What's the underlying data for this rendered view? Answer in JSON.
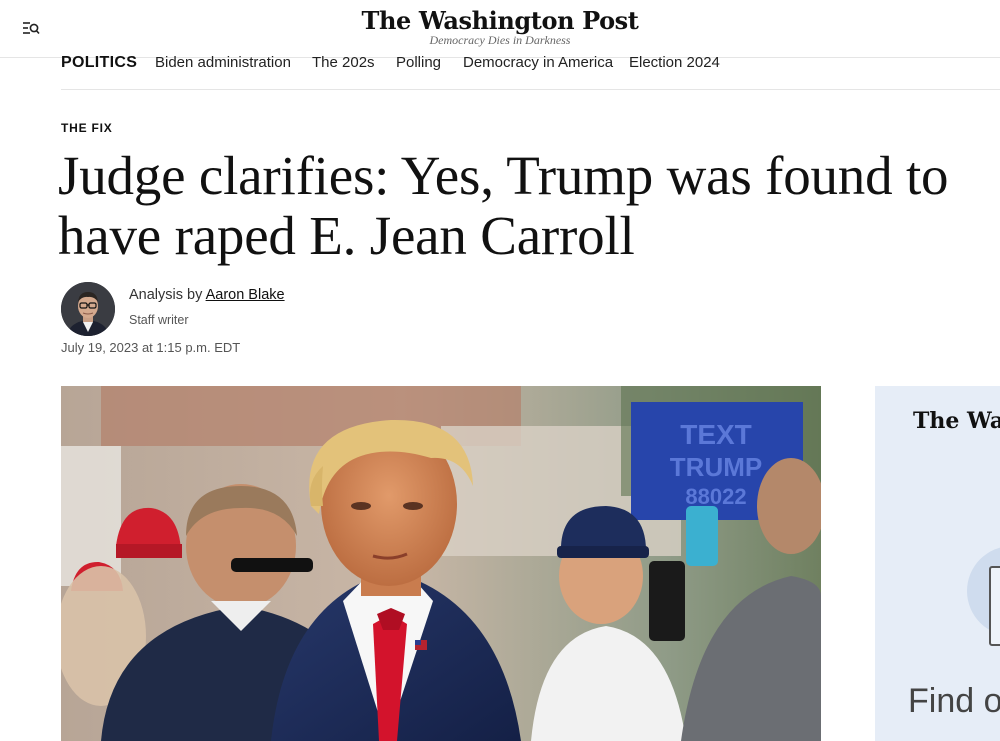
{
  "header": {
    "masthead": "The Washington Post",
    "tagline": "Democracy Dies in Darkness"
  },
  "nav": {
    "section": "POLITICS",
    "items": [
      "Biden administration",
      "The 202s",
      "Polling",
      "Democracy in America",
      "Election 2024"
    ]
  },
  "article": {
    "kicker": "THE FIX",
    "headline": "Judge clarifies: Yes, Trump was found to have raped E. Jean Carroll",
    "byline_prefix": "Analysis by",
    "author": "Aaron Blake",
    "author_role": "Staff writer",
    "timestamp": "July 19, 2023 at 1:15 p.m. EDT"
  },
  "ad": {
    "logo": "The Washington Post",
    "text": "Find o"
  },
  "colors": {
    "suit": "#1e2e59",
    "tie": "#d3132c",
    "hat": "#d01f2e",
    "sign": "#2540a8"
  }
}
